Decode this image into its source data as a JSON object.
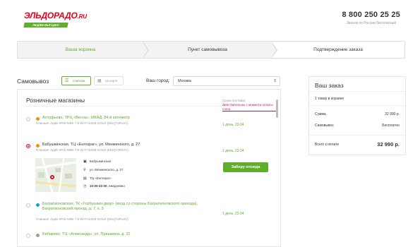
{
  "header": {
    "logo_main": "ЭЛЬДОРАДО",
    "logo_suffix": ".RU",
    "logo_tagline": "ЛЮДЯМ ВЫГОДНО",
    "phone": "8 800 250 25 25",
    "phone_note": "Звонок по России бесплатный"
  },
  "steps": [
    "Ваша корзина",
    "Пункт самовывоза",
    "Подтверждение заказа"
  ],
  "pickup": {
    "title": "Самовывоз",
    "view_list": "списком",
    "view_map": "на карте",
    "city_label": "Ваш город:",
    "city_value": "Москва"
  },
  "stores_panel": {
    "title": "Розничные магазины",
    "delivery_head": "Сроки поставки",
    "delivery_note": "Действительны с момента оплаты счета",
    "stores": [
      {
        "name": "Алтуфьево, ТРЦ «Веснa», МКАД, 84-й километр",
        "product": "Планшет Apple iPAD MINI 7.9 Wi-Fi 64GB GOLD (MUQY2RU/A)",
        "days": "1 день, 23.04",
        "dot_color": "#f39200"
      },
      {
        "name": "Бабушкинская, ТЦ «Eurospar», ул. Менжинского, д. 27",
        "product": "Планшет Apple iPAD MINI 7.9 Wi-Fi 64GB GOLD (MUQY2RU/A)",
        "days": "1 день, 23.04",
        "dot_color": "#f39200",
        "details": [
          {
            "icon": "metro-icon",
            "text": "Бабушкинская"
          },
          {
            "icon": "location-pin-icon",
            "text": "ул. Менжинского, д. 27"
          },
          {
            "icon": "building-icon",
            "text": "ТЦ «Eurospar»"
          },
          {
            "icon": "clock-icon",
            "hours": "10:00-22:00",
            "suffix": ", ежедневно"
          }
        ],
        "reserve_label": "Заберу отсюда"
      },
      {
        "name": "Багратионовская, ТК «Горбушкин двор» (вход со стороны Багратионовского проезда), Багратионовский проезд, д. 7, к. 3",
        "product": "Планшет Apple iPAD MINI 7.9 Wi-Fi 64GB GOLD (MUQY2RU/A)",
        "days": "1 день, 23.04",
        "dot_color": "#1e9bd7"
      },
      {
        "name": "Бибирево, ТЦ «Александр», ул. Пришвина, д. 22",
        "dot_color": "#9e9e9e"
      }
    ]
  },
  "order": {
    "title": "Ваш заказ",
    "count": "1 товар в корзине",
    "sum_label": "Сумма",
    "sum_value": "32 990 р.",
    "pickup_label": "Самовывоз",
    "pickup_value": "Бесплатно",
    "total_label": "Всего к оплате",
    "total_value": "32 990 р."
  },
  "colors": {
    "brand_red": "#e2001a",
    "accent_green": "#5fad2b",
    "note_magenta": "#c2185b"
  }
}
